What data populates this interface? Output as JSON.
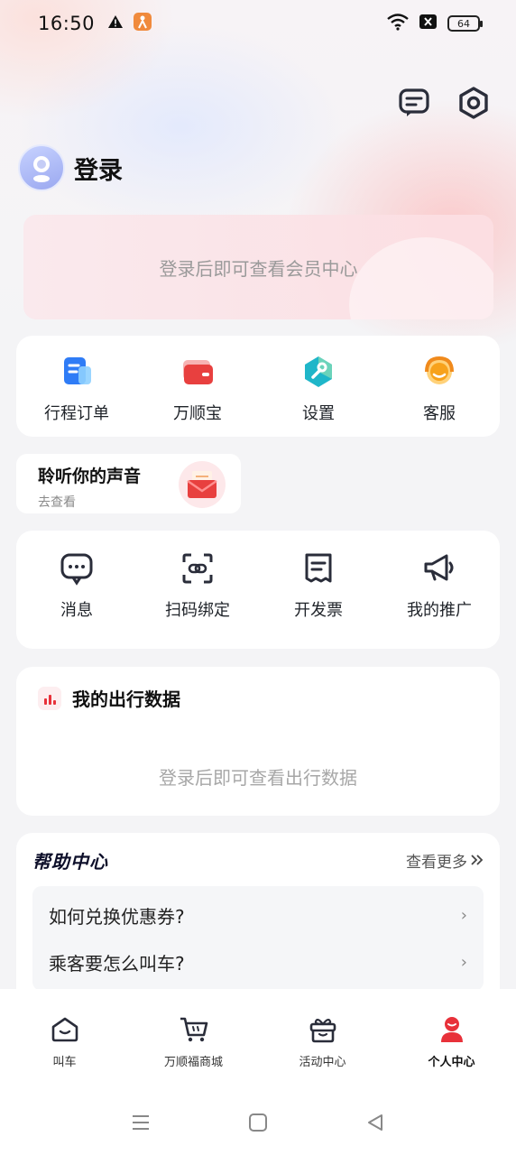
{
  "status_bar": {
    "time": "16:50",
    "battery": "64"
  },
  "profile": {
    "login_label": "登录"
  },
  "member_card": {
    "text": "登录后即可查看会员中心"
  },
  "quick_menu": [
    {
      "label": "行程订单",
      "icon": "trip-order-icon"
    },
    {
      "label": "万顺宝",
      "icon": "wallet-icon"
    },
    {
      "label": "设置",
      "icon": "settings-wrench-icon"
    },
    {
      "label": "客服",
      "icon": "customer-service-icon"
    }
  ],
  "voice_card": {
    "title": "聆听你的声音",
    "subtitle": "去查看"
  },
  "tools": [
    {
      "label": "消息",
      "icon": "message-icon"
    },
    {
      "label": "扫码绑定",
      "icon": "scan-bind-icon"
    },
    {
      "label": "开发票",
      "icon": "invoice-icon"
    },
    {
      "label": "我的推广",
      "icon": "megaphone-icon"
    }
  ],
  "travel_data": {
    "title": "我的出行数据",
    "empty_text": "登录后即可查看出行数据"
  },
  "help_center": {
    "title": "帮助中心",
    "more_label": "查看更多",
    "items": [
      "如何兑换优惠券?",
      "乘客要怎么叫车?"
    ]
  },
  "tabbar": [
    {
      "label": "叫车",
      "icon": "home-icon",
      "active": false
    },
    {
      "label": "万顺福商城",
      "icon": "cart-icon",
      "active": false
    },
    {
      "label": "活动中心",
      "icon": "gift-box-icon",
      "active": false
    },
    {
      "label": "个人中心",
      "icon": "person-icon",
      "active": true
    }
  ],
  "colors": {
    "accent": "#e8313a",
    "blue": "#2f7cf6",
    "teal": "#1fb6c9",
    "orange": "#f7a21b"
  }
}
